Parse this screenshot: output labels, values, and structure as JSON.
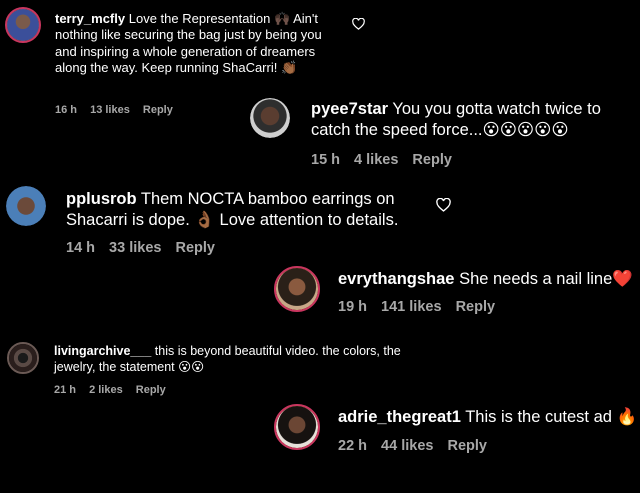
{
  "comments": [
    {
      "user": "terry_mcfly",
      "text": "Love the Representation 🙌🏿 Ain't nothing like securing the bag just by being you and inspiring a whole generation of dreamers along the way. Keep running ShaCarri! 👏🏾",
      "time": "16 h",
      "likes": "13 likes",
      "reply": "Reply"
    },
    {
      "user": "pyee7star",
      "text": "You you gotta watch twice to catch the speed force...😮😮😮😮😮",
      "time": "15 h",
      "likes": "4 likes",
      "reply": "Reply"
    },
    {
      "user": "pplusrob",
      "text": "Them NOCTA bamboo earrings on Shacarri is dope. 👌🏾 Love attention to details.",
      "time": "14 h",
      "likes": "33 likes",
      "reply": "Reply"
    },
    {
      "user": "evrythangshae",
      "text": "She needs a nail line❤️",
      "time": "19 h",
      "likes": "141 likes",
      "reply": "Reply"
    },
    {
      "user": "livingarchive___",
      "text": "this is beyond beautiful video. the colors, the jewelry, the statement 😮😮",
      "time": "21 h",
      "likes": "2 likes",
      "reply": "Reply"
    },
    {
      "user": "adrie_thegreat1",
      "text": "This is the cutest ad 🔥",
      "time": "22 h",
      "likes": "44 likes",
      "reply": "Reply"
    }
  ],
  "colors": {
    "background": "#000000",
    "meta": "#a8a8a8",
    "story_ring": "#c9365f"
  }
}
